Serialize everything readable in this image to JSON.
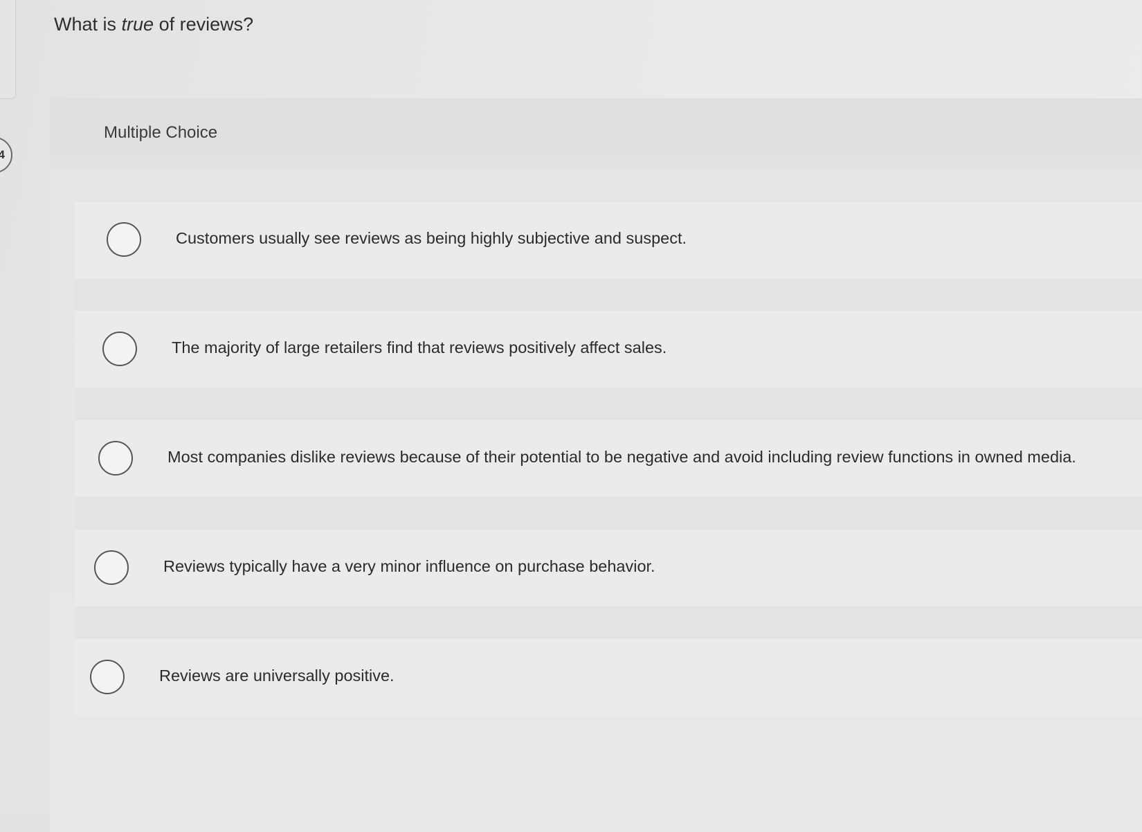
{
  "question": {
    "number": "4",
    "prompt_before": "What is ",
    "prompt_emphasis": "true",
    "prompt_after": " of reviews?"
  },
  "panel": {
    "label": "Multiple Choice"
  },
  "options": [
    {
      "label": "Customers usually see reviews as being highly subjective and suspect.",
      "selected": false
    },
    {
      "label": "The majority of large retailers find that reviews positively affect sales.",
      "selected": false
    },
    {
      "label": "Most companies dislike reviews because of their potential to be negative and avoid including review functions in owned media.",
      "selected": false
    },
    {
      "label": "Reviews typically have a very minor influence on purchase behavior.",
      "selected": false
    },
    {
      "label": "Reviews are universally positive.",
      "selected": false
    }
  ]
}
